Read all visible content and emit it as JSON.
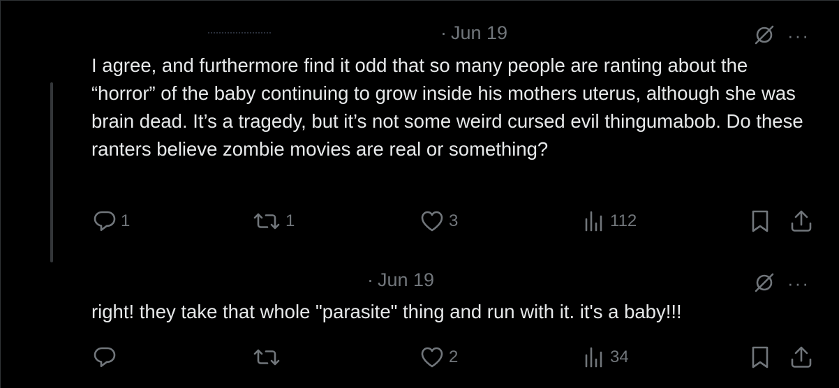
{
  "tweets": [
    {
      "date": "Jun 19",
      "text": "I agree, and furthermore find it odd that so many people are ranting about the “horror” of the baby continuing to grow inside his mothers uterus, although she was brain dead. It’s a tragedy, but it’s not some weird cursed evil thingumabob. Do these ranters believe zombie movies are real or something?",
      "replies": "1",
      "reposts": "1",
      "likes": "3",
      "views": "112"
    },
    {
      "date": "Jun 19",
      "text": "right! they take that whole \"parasite\" thing and run with it. it's a baby!!!",
      "replies": "",
      "reposts": "",
      "likes": "2",
      "views": "34"
    }
  ],
  "ui": {
    "separator": "·",
    "more": "···"
  },
  "icons": [
    "reply-icon",
    "repost-icon",
    "like-icon",
    "views-icon",
    "bookmark-icon",
    "share-icon",
    "grok-icon",
    "more-icon"
  ],
  "colors": {
    "background": "#000000",
    "text": "#e7e9ea",
    "muted": "#71767b",
    "thread_line": "#333639"
  }
}
